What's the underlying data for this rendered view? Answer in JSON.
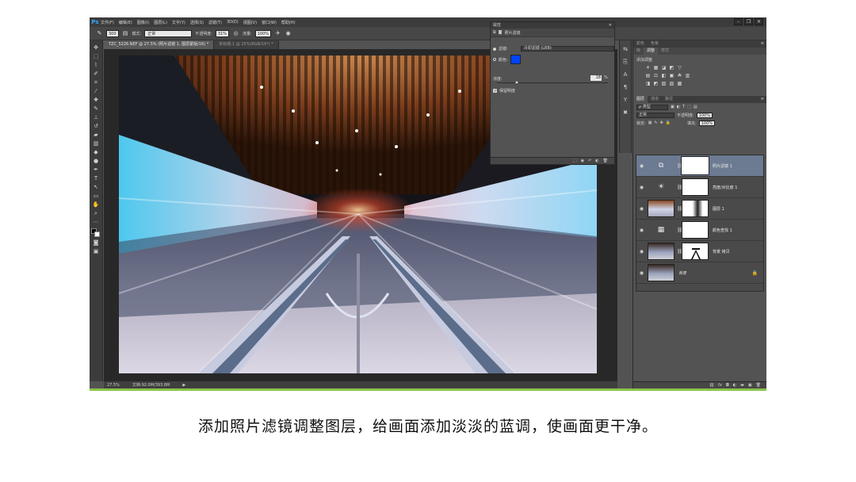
{
  "app": {
    "logo": "Ps",
    "menu": [
      "文件(F)",
      "编辑(E)",
      "图像(I)",
      "图层(L)",
      "文字(Y)",
      "选择(S)",
      "滤镜(T)",
      "3D(D)",
      "视图(V)",
      "窗口(W)",
      "帮助(H)"
    ],
    "window_controls": [
      "–",
      "❐",
      "✕"
    ]
  },
  "options_bar": {
    "brush_size": "300",
    "mode_label": "模式:",
    "mode_value": "正常",
    "opacity_label": "不透明度:",
    "opacity_value": "31%",
    "flow_label": "流量:",
    "flow_value": "100%"
  },
  "document_tabs": [
    {
      "label": "TZC_5226.NEF @ 27.5% (照片滤镜 1, 图层蒙版/16) *",
      "active": true
    },
    {
      "label": "未标题-1 @ 25%(RGB/16*) *",
      "active": false
    }
  ],
  "status_bar": {
    "zoom": "27.5%",
    "doc_info": "文档:92.0M/393.8M",
    "arrow": "▶"
  },
  "properties_panel": {
    "title": "属性",
    "close": "✕",
    "header_label": "照片滤镜",
    "filter_label": "滤镜:",
    "filter_value": "冷却滤镜 (LBB)",
    "color_label": "颜色:",
    "color_value": "#0044ff",
    "density_label": "浓度:",
    "density_value": "18",
    "density_unit": "%",
    "density_level_pct": 18,
    "preserve_label": "保留明度",
    "footer_icons": [
      "⬚",
      "◉",
      "↶",
      "◐",
      "🗑"
    ]
  },
  "top_panel": {
    "tabs": [
      "颜色",
      "色板"
    ],
    "tabs_adjust": [
      "库",
      "调整",
      "样式"
    ],
    "adjust_title": "添加调整",
    "row1": [
      "☀",
      "▦",
      "◪",
      "◩",
      "▽"
    ],
    "row2": [
      "▤",
      "⚖",
      "◧",
      "▣",
      "☘",
      "▥"
    ],
    "row3": [
      "◨",
      "◩",
      "▧",
      "▨",
      "▩"
    ]
  },
  "layers_panel": {
    "tabs": [
      "图层",
      "通道",
      "路径"
    ],
    "kind_label": "ρ 类型",
    "kind_icons": [
      "▣",
      "◐",
      "T",
      "⬚",
      "▤"
    ],
    "blend_value": "正常",
    "opacity_label": "不透明度:",
    "opacity_value": "100%",
    "lock_label": "锁定:",
    "lock_icons": [
      "▦",
      "✎",
      "✥",
      "🔒"
    ],
    "fill_label": "填充:",
    "fill_value": "100%",
    "layers": [
      {
        "name": "照片滤镜 1",
        "type": "adjustment",
        "icon": "⧉",
        "selected": true
      },
      {
        "name": "亮度/对比度 1",
        "type": "adjustment",
        "icon": "☀",
        "selected": false
      },
      {
        "name": "图层 1",
        "type": "pixel",
        "selected": false
      },
      {
        "name": "颜色查找 1",
        "type": "adjustment",
        "icon": "▦",
        "selected": false
      },
      {
        "name": "背景 拷贝",
        "type": "pixel",
        "selected": false
      },
      {
        "name": "背景",
        "type": "background",
        "selected": false
      }
    ],
    "footer_icons": [
      "⛓",
      "fx",
      "◘",
      "◐",
      "▬",
      "▣",
      "🗑"
    ]
  },
  "caption": "添加照片滤镜调整图层，给画面添加淡淡的蓝调，使画面更干净。",
  "colors": {
    "ui_bg": "#535353",
    "menubar": "#3c3c3c",
    "selected_layer": "#6c7a92",
    "photo_filter_color": "#0044ff"
  }
}
